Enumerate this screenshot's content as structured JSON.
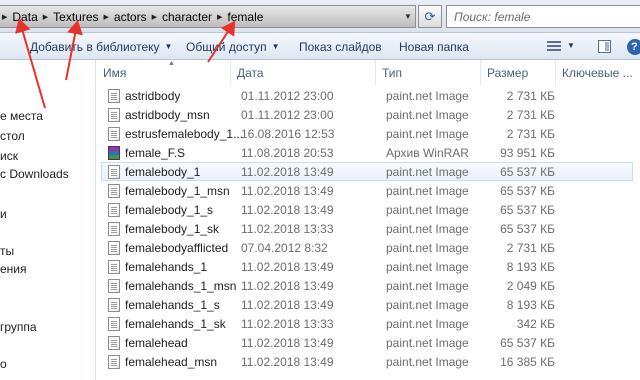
{
  "address": {
    "crumbs": [
      "Data",
      "Textures",
      "actors",
      "character",
      "female"
    ]
  },
  "search": {
    "placeholder": "Поиск: female"
  },
  "toolbar": {
    "add_to_library": "Добавить в библиотеку",
    "share": "Общий доступ",
    "slideshow": "Показ слайдов",
    "new_folder": "Новая папка"
  },
  "nav": {
    "items": [
      "е места",
      "стол",
      "иск",
      "с Downloads",
      "и",
      "ты",
      "ения",
      "группа",
      "о"
    ]
  },
  "columns": {
    "name": "Имя",
    "date": "Дата",
    "type": "Тип",
    "size": "Размер",
    "keywords": "Ключевые ..."
  },
  "files": [
    {
      "name": "astridbody",
      "date": "01.11.2012 23:00",
      "type": "paint.net Image",
      "size": "2 731 КБ",
      "icon": "file-icon"
    },
    {
      "name": "astridbody_msn",
      "date": "01.11.2012 23:00",
      "type": "paint.net Image",
      "size": "2 731 КБ",
      "icon": "file-icon"
    },
    {
      "name": "estrusfemalebody_1...",
      "date": "16.08.2016 12:53",
      "type": "paint.net Image",
      "size": "2 731 КБ",
      "icon": "file-icon"
    },
    {
      "name": "female_F.S",
      "date": "11.08.2018 20:53",
      "type": "Архив WinRAR",
      "size": "93 951 КБ",
      "icon": "rar-icon"
    },
    {
      "name": "femalebody_1",
      "date": "11.02.2018 13:49",
      "type": "paint.net Image",
      "size": "65 537 КБ",
      "icon": "file-icon",
      "selected": true
    },
    {
      "name": "femalebody_1_msn",
      "date": "11.02.2018 13:49",
      "type": "paint.net Image",
      "size": "65 537 КБ",
      "icon": "file-icon"
    },
    {
      "name": "femalebody_1_s",
      "date": "11.02.2018 13:49",
      "type": "paint.net Image",
      "size": "65 537 КБ",
      "icon": "file-icon"
    },
    {
      "name": "femalebody_1_sk",
      "date": "11.02.2018 13:33",
      "type": "paint.net Image",
      "size": "65 537 КБ",
      "icon": "file-icon"
    },
    {
      "name": "femalebodyafflicted",
      "date": "07.04.2012 8:32",
      "type": "paint.net Image",
      "size": "2 731 КБ",
      "icon": "file-icon"
    },
    {
      "name": "femalehands_1",
      "date": "11.02.2018 13:49",
      "type": "paint.net Image",
      "size": "8 193 КБ",
      "icon": "file-icon"
    },
    {
      "name": "femalehands_1_msn",
      "date": "11.02.2018 13:49",
      "type": "paint.net Image",
      "size": "2 049 КБ",
      "icon": "file-icon"
    },
    {
      "name": "femalehands_1_s",
      "date": "11.02.2018 13:49",
      "type": "paint.net Image",
      "size": "8 193 КБ",
      "icon": "file-icon"
    },
    {
      "name": "femalehands_1_sk",
      "date": "11.02.2018 13:33",
      "type": "paint.net Image",
      "size": "342 КБ",
      "icon": "file-icon"
    },
    {
      "name": "femalehead",
      "date": "11.02.2018 13:49",
      "type": "paint.net Image",
      "size": "65 537 КБ",
      "icon": "file-icon"
    },
    {
      "name": "femalehead_msn",
      "date": "11.02.2018 13:49",
      "type": "paint.net Image",
      "size": "16 385 КБ",
      "icon": "file-icon"
    }
  ],
  "colors": {
    "annotation_arrow": "#e8312a",
    "selection": "#eaf2fb"
  }
}
